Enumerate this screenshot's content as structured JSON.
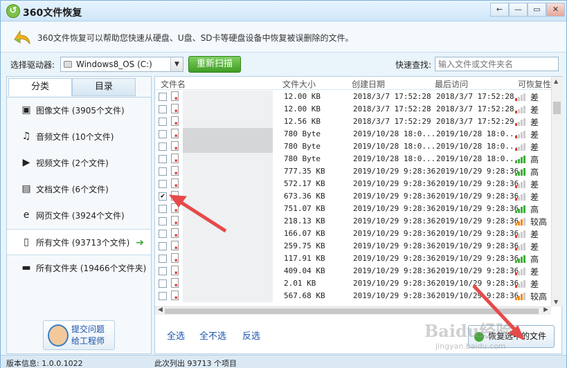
{
  "window": {
    "title": "360文件恢复",
    "logo_glyph": "↺",
    "controls": {
      "back": "←",
      "minimize": "—",
      "restore": "▭",
      "close": "✕"
    }
  },
  "banner": {
    "icon": "recycle-arrow-icon",
    "text": "360文件恢复可以帮助您快速从硬盘、U盘、SD卡等硬盘设备中恢复被误删除的文件。"
  },
  "toolbar": {
    "drive_label": "选择驱动器:",
    "drive_value": "Windows8_OS (C:)",
    "rescan_label": "重新扫描",
    "quick_search_label": "快速查找:",
    "search_placeholder": "输入文件或文件夹名"
  },
  "left": {
    "tabs": [
      {
        "label": "分类",
        "active": true
      },
      {
        "label": "目录",
        "active": false
      }
    ],
    "categories": [
      {
        "label": "图像文件 (3905个文件)",
        "icon": "image-icon",
        "glyph": "▣"
      },
      {
        "label": "音频文件 (10个文件)",
        "icon": "music-icon",
        "glyph": "♫"
      },
      {
        "label": "视频文件 (2个文件)",
        "icon": "video-icon",
        "glyph": "▶"
      },
      {
        "label": "文档文件 (6个文件)",
        "icon": "document-icon",
        "glyph": "▤"
      },
      {
        "label": "网页文件 (3924个文件)",
        "icon": "web-icon",
        "glyph": "e"
      },
      {
        "label": "所有文件 (93713个文件)",
        "icon": "file-icon",
        "glyph": "▯",
        "selected": true,
        "arrow": "➔"
      },
      {
        "label": "所有文件夹 (19466个文件夹)",
        "icon": "folder-icon",
        "glyph": "▬"
      }
    ],
    "support": {
      "line1": "提交问题",
      "line2": "给工程师"
    }
  },
  "table": {
    "headers": [
      "文件名",
      "文件大小",
      "创建日期",
      "最后访问",
      "可恢复性"
    ],
    "rows": [
      {
        "checked": false,
        "size": "12.00 KB",
        "created": "2018/3/7 17:52:28",
        "accessed": "2018/3/7 17:52:28",
        "level": 1,
        "recov": "差",
        "blur": "light"
      },
      {
        "checked": false,
        "size": "12.00 KB",
        "created": "2018/3/7 17:52:28",
        "accessed": "2018/3/7 17:52:28",
        "level": 1,
        "recov": "差",
        "blur": "light"
      },
      {
        "checked": false,
        "size": "12.56 KB",
        "created": "2018/3/7 17:52:29",
        "accessed": "2018/3/7 17:52:29",
        "level": 1,
        "recov": "差",
        "blur": "light"
      },
      {
        "checked": false,
        "size": "780 Byte",
        "created": "2019/10/28 18:0...",
        "accessed": "2019/10/28 18:0...",
        "level": 1,
        "recov": "差",
        "blur": "dark"
      },
      {
        "checked": false,
        "size": "780 Byte",
        "created": "2019/10/28 18:0...",
        "accessed": "2019/10/28 18:0...",
        "level": 1,
        "recov": "差",
        "blur": "dark"
      },
      {
        "checked": false,
        "size": "780 Byte",
        "created": "2019/10/28 18:0...",
        "accessed": "2019/10/28 18:0...",
        "level": 4,
        "recov": "高",
        "blur": "light"
      },
      {
        "checked": false,
        "size": "777.35 KB",
        "created": "2019/10/29 9:28:36",
        "accessed": "2019/10/29 9:28:36",
        "level": 4,
        "recov": "高",
        "blur": "light"
      },
      {
        "checked": false,
        "size": "572.17 KB",
        "created": "2019/10/29 9:28:36",
        "accessed": "2019/10/29 9:28:36",
        "level": 1,
        "recov": "差",
        "blur": "light"
      },
      {
        "checked": true,
        "size": "673.36 KB",
        "created": "2019/10/29 9:28:36",
        "accessed": "2019/10/29 9:28:36",
        "level": 1,
        "recov": "差",
        "blur": "light"
      },
      {
        "checked": false,
        "size": "751.07 KB",
        "created": "2019/10/29 9:28:36",
        "accessed": "2019/10/29 9:28:36",
        "level": 4,
        "recov": "高",
        "blur": "light"
      },
      {
        "checked": false,
        "size": "218.13 KB",
        "created": "2019/10/29 9:28:36",
        "accessed": "2019/10/29 9:28:36",
        "level": 3,
        "recov": "较高",
        "blur": "light"
      },
      {
        "checked": false,
        "size": "166.07 KB",
        "created": "2019/10/29 9:28:36",
        "accessed": "2019/10/29 9:28:36",
        "level": 1,
        "recov": "差",
        "blur": "light"
      },
      {
        "checked": false,
        "size": "259.75 KB",
        "created": "2019/10/29 9:28:36",
        "accessed": "2019/10/29 9:28:36",
        "level": 1,
        "recov": "差",
        "blur": "light"
      },
      {
        "checked": false,
        "size": "117.91 KB",
        "created": "2019/10/29 9:28:36",
        "accessed": "2019/10/29 9:28:36",
        "level": 4,
        "recov": "高",
        "blur": "light"
      },
      {
        "checked": false,
        "size": "409.04 KB",
        "created": "2019/10/29 9:28:36",
        "accessed": "2019/10/29 9:28:36",
        "level": 1,
        "recov": "差",
        "blur": "light"
      },
      {
        "checked": false,
        "size": "2.01 KB",
        "created": "2019/10/29 9:28:36",
        "accessed": "2019/10/29 9:28:36",
        "level": 1,
        "recov": "差",
        "blur": "light"
      },
      {
        "checked": false,
        "size": "567.68 KB",
        "created": "2019/10/29 9:28:36",
        "accessed": "2019/10/29 9:28:36",
        "level": 3,
        "recov": "较高",
        "blur": "light"
      }
    ],
    "check_glyph": "✔"
  },
  "actions": {
    "select_all": "全选",
    "select_none": "全不选",
    "invert": "反选",
    "recover": "恢复选中的文件"
  },
  "status": {
    "version": "版本信息: 1.0.0.1022",
    "count": "此次列出 93713 个项目"
  },
  "watermark": {
    "text": "Baidu经验",
    "sub": "jingyan.baidu.com"
  },
  "colors": {
    "level_red": "#e03a2a",
    "level_orange": "#f08a1c",
    "level_green": "#3fae3a",
    "level_empty": "#cccccc",
    "annotation_arrow": "#e64a4a"
  }
}
